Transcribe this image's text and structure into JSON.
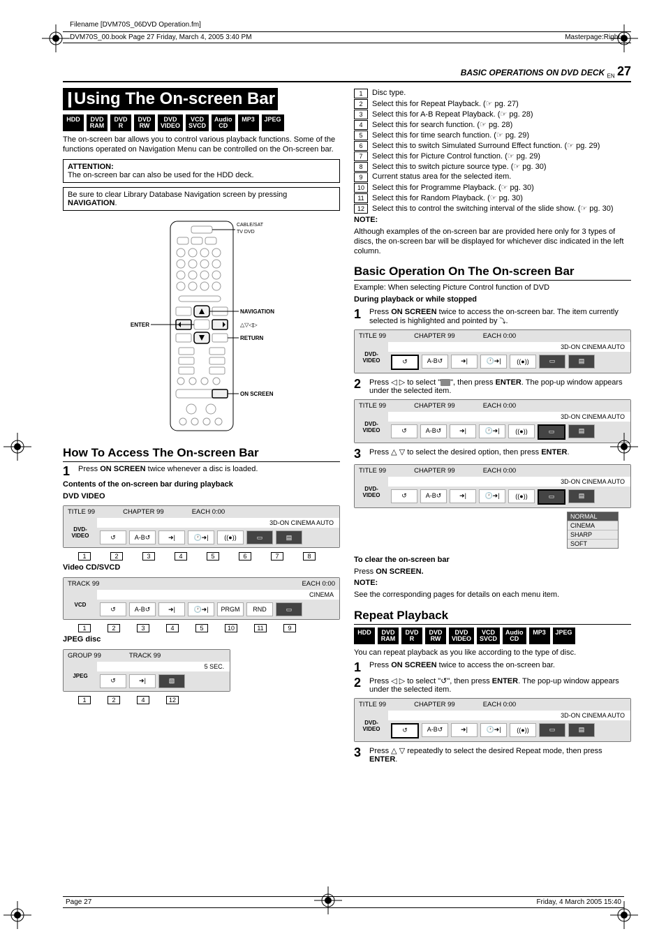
{
  "page": {
    "filename_line": "Filename [DVM70S_06DVD Operation.fm]",
    "book_info": "DVM70S_00.book  Page 27  Friday, March 4, 2005  3:40 PM",
    "masterpage": "Masterpage:Right+",
    "running_head": "BASIC OPERATIONS ON DVD DECK",
    "lang_code": "EN",
    "page_number": "27",
    "footer_left": "Page 27",
    "footer_right": "Friday, 4 March 2005  15:40"
  },
  "left": {
    "title": "Using The On-screen Bar",
    "badges": [
      "HDD",
      "DVD RAM",
      "DVD R",
      "DVD RW",
      "DVD VIDEO",
      "VCD SVCD",
      "Audio CD",
      "MP3",
      "JPEG"
    ],
    "intro": "The on-screen bar allows you to control various playback functions. Some of the functions operated on Navigation Menu can be controlled on the On-screen bar.",
    "attention_label": "ATTENTION:",
    "attention_body": "The on-screen bar can also be used for the HDD deck.",
    "clear_note_pre": "Be sure to clear Library Database Navigation screen by pressing ",
    "clear_note_bold": "NAVIGATION",
    "clear_note_post": ".",
    "remote_labels": {
      "cable_sat": "CABLE/SAT",
      "tv_dvd": "TV DVD",
      "enter": "ENTER",
      "navigation": "NAVIGATION",
      "arrows": "△▽◁▷",
      "return": "RETURN",
      "on_screen": "ON SCREEN"
    },
    "how_access_head": "How To Access The On-screen Bar",
    "access_step1_pre": "Press ",
    "access_step1_bold": "ON SCREEN",
    "access_step1_post": " twice whenever a disc is loaded.",
    "contents_head": "Contents of the on-screen bar during playback",
    "dvd_video_label": "DVD VIDEO",
    "osb_dvd": {
      "title": "TITLE 99",
      "chapter": "CHAPTER 99",
      "each": "EACH 0:00",
      "left_l1": "DVD-",
      "left_l2": "VIDEO",
      "status": "3D-ON   CINEMA   AUTO"
    },
    "dvd_callouts": [
      "1",
      "2",
      "3",
      "4",
      "5",
      "6",
      "7",
      "8"
    ],
    "vcd_label": "Video CD/SVCD",
    "osb_vcd": {
      "track": "TRACK 99",
      "each": "EACH 0:00",
      "left": "VCD",
      "status": "CINEMA",
      "prgm": "PRGM",
      "rnd": "RND"
    },
    "vcd_callouts": [
      "1",
      "2",
      "3",
      "4",
      "5",
      "10",
      "11",
      "9"
    ],
    "jpeg_label": "JPEG disc",
    "osb_jpeg": {
      "group": "GROUP 99",
      "track": "TRACK 99",
      "sec": "5 SEC.",
      "left": "JPEG"
    },
    "jpeg_callouts": [
      "1",
      "2",
      "4",
      "12"
    ]
  },
  "right": {
    "callouts": [
      {
        "n": "1",
        "t": "Disc type."
      },
      {
        "n": "2",
        "t": "Select this for Repeat Playback. (☞ pg. 27)"
      },
      {
        "n": "3",
        "t": "Select this for A-B Repeat Playback. (☞ pg. 28)"
      },
      {
        "n": "4",
        "t": "Select this for search function. (☞ pg. 28)"
      },
      {
        "n": "5",
        "t": "Select this for time search function. (☞ pg. 29)"
      },
      {
        "n": "6",
        "t": "Select this to switch Simulated Surround Effect function. (☞ pg. 29)"
      },
      {
        "n": "7",
        "t": "Select this for Picture Control function. (☞ pg. 29)"
      },
      {
        "n": "8",
        "t": "Select this to switch picture source type. (☞ pg. 30)"
      },
      {
        "n": "9",
        "t": "Current status area for the selected item."
      },
      {
        "n": "10",
        "t": "Select this for Programme Playback. (☞ pg. 30)"
      },
      {
        "n": "11",
        "t": "Select this for Random Playback. (☞ pg. 30)"
      },
      {
        "n": "12",
        "t": "Select this to control the switching interval of the slide show. (☞ pg. 30)"
      }
    ],
    "note1_label": "NOTE:",
    "note1_body": "Although examples of the on-screen bar are provided here only for 3 types of discs, the on-screen bar will be displayed for whichever disc indicated in the left column.",
    "basic_op_head": "Basic Operation On The On-screen Bar",
    "basic_example": "Example: When selecting Picture Control function of DVD",
    "during_label": "During playback or while stopped",
    "step1_pre": "Press ",
    "step1_bold": "ON SCREEN",
    "step1_mid": " twice to access the on-screen bar. The item currently selected is highlighted and pointed by ",
    "step1_post": ".",
    "step2_pre": "Press ◁ ▷ to select \"",
    "step2_mid": "\", then press ",
    "step2_bold": "ENTER",
    "step2_post": ". The pop-up window appears under the selected item.",
    "step3_pre": "Press △ ▽ to select the desired option, then press ",
    "step3_bold": "ENTER",
    "step3_post": ".",
    "dropdown": [
      "NORMAL",
      "CINEMA",
      "SHARP",
      "SOFT"
    ],
    "clear_head": "To clear the on-screen bar",
    "clear_body_pre": "Press ",
    "clear_body_bold": "ON SCREEN.",
    "note2_label": "NOTE:",
    "note2_body": "See the corresponding pages for details on each menu item.",
    "repeat_head": "Repeat Playback",
    "repeat_badges": [
      "HDD",
      "DVD RAM",
      "DVD R",
      "DVD RW",
      "DVD VIDEO",
      "VCD SVCD",
      "Audio CD",
      "MP3",
      "JPEG"
    ],
    "repeat_intro": "You can repeat playback as you like according to the type of disc.",
    "rstep1_pre": "Press ",
    "rstep1_bold": "ON SCREEN",
    "rstep1_post": " twice to access the on-screen bar.",
    "rstep2_pre": "Press ◁ ▷ to select \"",
    "rstep2_icon": "↺",
    "rstep2_mid": "\", then press ",
    "rstep2_bold": "ENTER",
    "rstep2_post": ". The pop-up window appears under the selected item.",
    "rstep3_pre": "Press △ ▽ repeatedly to select the desired Repeat mode, then press ",
    "rstep3_bold": "ENTER",
    "rstep3_post": "."
  }
}
